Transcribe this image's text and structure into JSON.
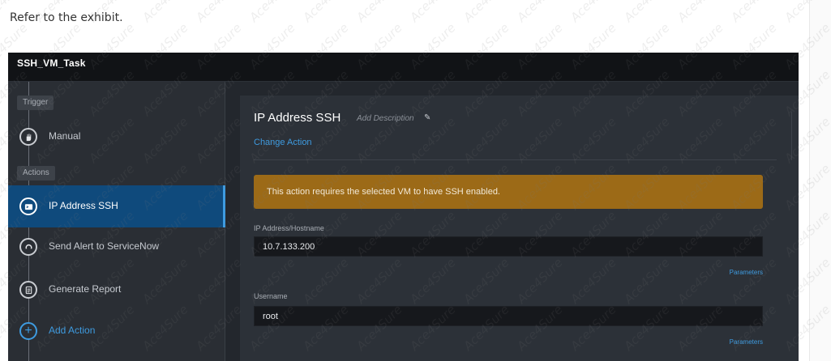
{
  "intro_text": "Refer to the exhibit.",
  "app": {
    "title": "SSH_VM_Task"
  },
  "sidebar": {
    "trigger_label": "Trigger",
    "trigger_item": {
      "label": "Manual",
      "icon": "hand-icon"
    },
    "actions_label": "Actions",
    "actions": [
      {
        "label": "IP Address SSH",
        "icon": "terminal-icon",
        "active": true
      },
      {
        "label": "Send Alert to ServiceNow",
        "icon": "servicenow-icon",
        "active": false
      },
      {
        "label": "Generate Report",
        "icon": "report-icon",
        "active": false
      }
    ],
    "add_action": {
      "label": "Add Action",
      "icon": "plus-icon"
    }
  },
  "panel": {
    "title": "IP Address SSH",
    "add_description": "Add Description",
    "change_action": "Change Action",
    "alert": "This action requires the selected VM to have SSH enabled.",
    "fields": [
      {
        "label": "IP Address/Hostname",
        "value": "10.7.133.200",
        "parameters": "Parameters"
      },
      {
        "label": "Username",
        "value": "root",
        "parameters": "Parameters"
      }
    ]
  },
  "watermark": "Ace4Sure",
  "colors": {
    "active_blue": "#0f4a7c",
    "link_blue": "#3e9be0",
    "alert_amber": "#9c6a17",
    "topbar": "#111316",
    "sidebar": "#2a2e34"
  }
}
